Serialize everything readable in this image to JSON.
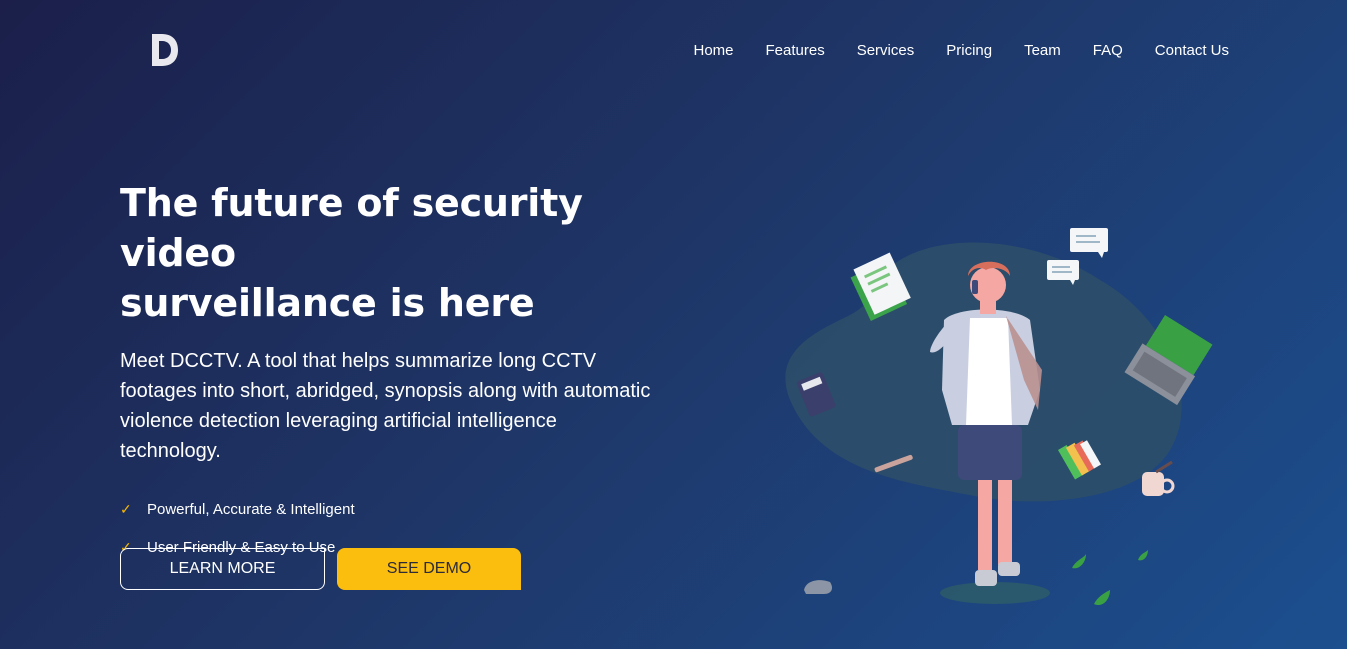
{
  "brand": {
    "logo_letter": "D"
  },
  "nav": {
    "items": [
      {
        "label": "Home"
      },
      {
        "label": "Features"
      },
      {
        "label": "Services"
      },
      {
        "label": "Pricing"
      },
      {
        "label": "Team"
      },
      {
        "label": "FAQ"
      },
      {
        "label": "Contact Us"
      }
    ]
  },
  "hero": {
    "title_line1": "The future of security video",
    "title_line2": "surveillance is here",
    "description": "Meet DCCTV. A tool that helps summarize long CCTV footages into short, abridged, synopsis along with automatic violence detection leveraging artificial intelligence technology.",
    "features": [
      {
        "text": "Powerful, Accurate & Intelligent",
        "icon": "check-icon"
      },
      {
        "text": "User Friendly & Easy to Use",
        "icon": "check-icon"
      }
    ]
  },
  "buttons": {
    "learn_more": "LEARN MORE",
    "see_demo": "SEE DEMO"
  },
  "colors": {
    "accent": "#fbbd0e",
    "bg_start": "#1b1f4a",
    "bg_end": "#1c4f8f",
    "blob": "#2e4f68"
  }
}
